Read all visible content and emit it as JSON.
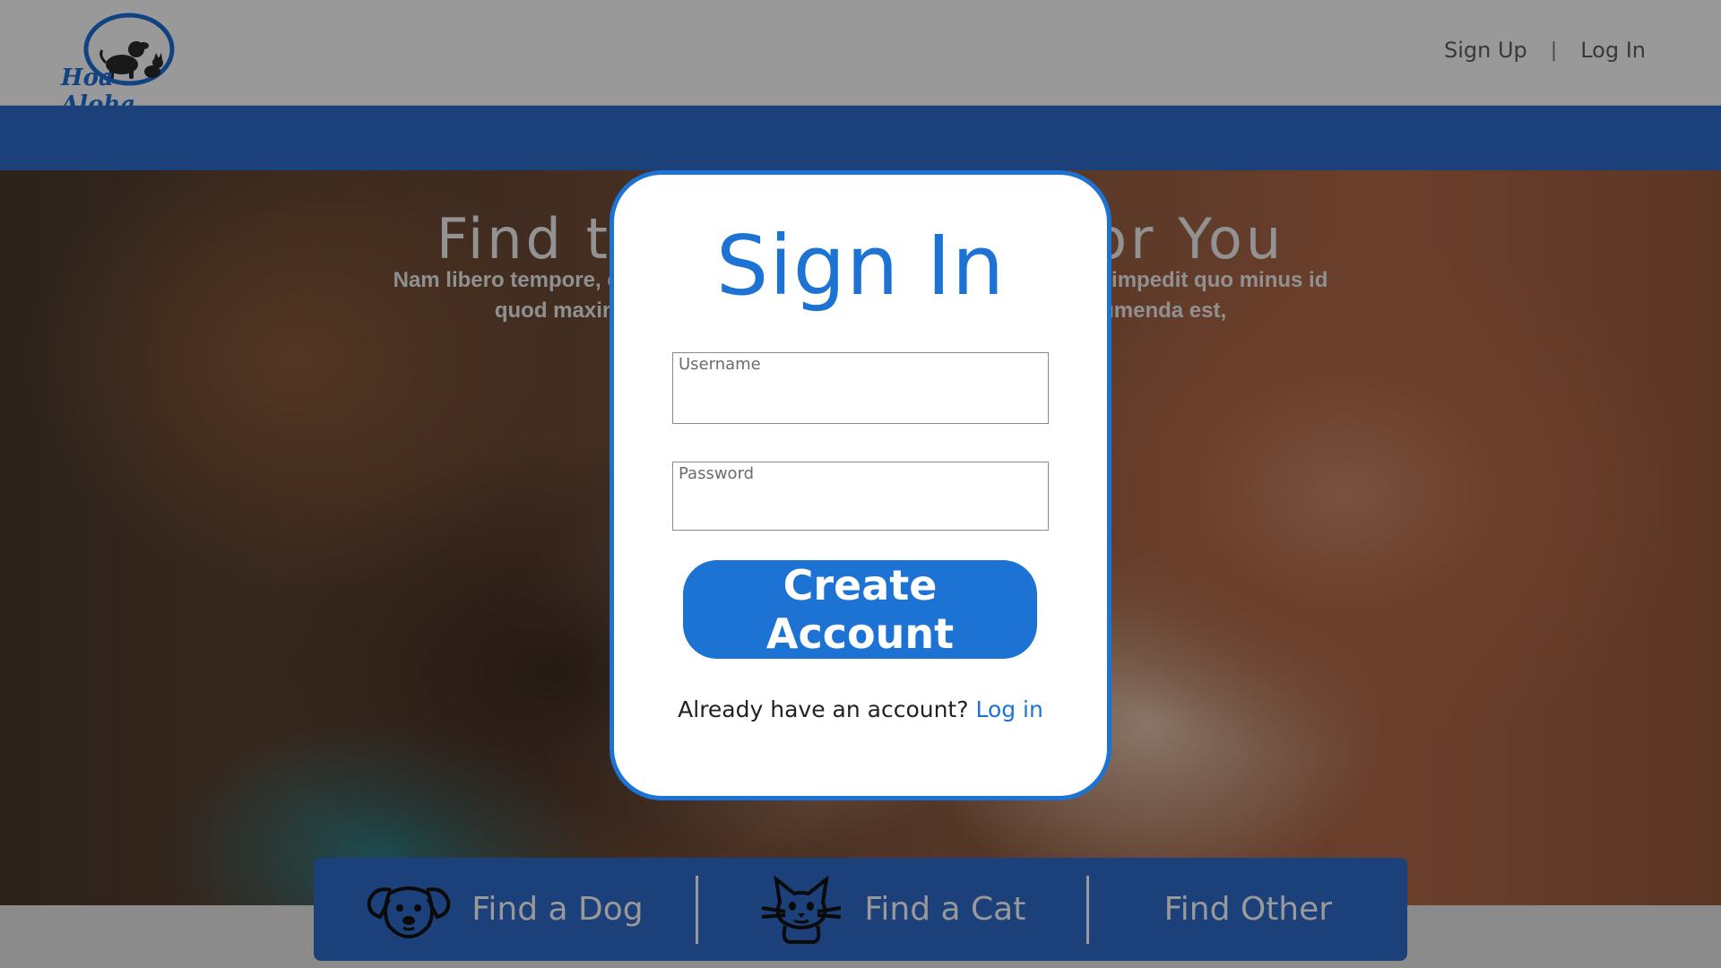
{
  "header": {
    "logo_text": "Hoa Aloha",
    "nav": {
      "sign_up": "Sign Up",
      "separator": "|",
      "log_in": "Log In"
    }
  },
  "hero": {
    "title": "Find the Perfect Pet for You",
    "text": "Nam libero tempore, cum soluta nobis est eligendi optio cumque nihil impedit quo minus id quod maxime placeat facere possimus, omnis voluptas assumenda est,"
  },
  "finder": {
    "dog": {
      "label": "Find a Dog",
      "icon": "dog-icon"
    },
    "cat": {
      "label": "Find a Cat",
      "icon": "cat-icon"
    },
    "other": {
      "label": "Find Other"
    }
  },
  "modal": {
    "title": "Sign In",
    "username": {
      "label": "Username",
      "value": ""
    },
    "password": {
      "label": "Password",
      "value": ""
    },
    "create_button": "Create Account",
    "login_prompt": "Already have an account?",
    "login_link": "Log in"
  },
  "colors": {
    "accent": "#1d73d4",
    "bar_blue": "#2d6bcc",
    "overlay": "rgba(0,0,0,0.40)"
  }
}
